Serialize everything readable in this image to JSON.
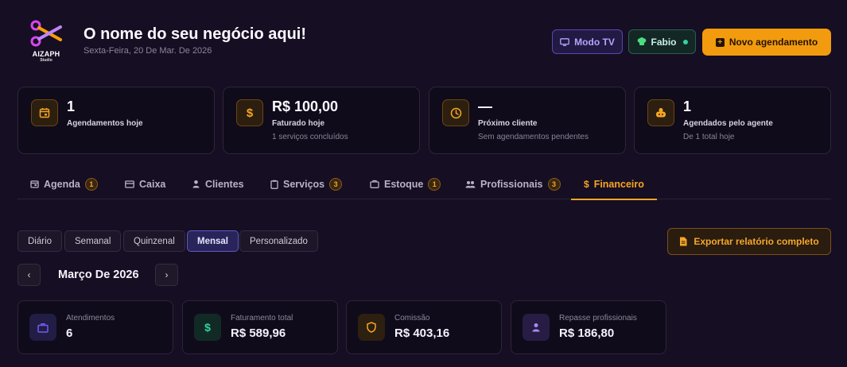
{
  "brand": {
    "name": "AIZAPH",
    "tagline": "Studio"
  },
  "header": {
    "title": "O nome do seu negócio aqui!",
    "date": "Sexta-Feira, 20 De Mar. De 2026",
    "tv_button": "Modo TV",
    "user_name": "Fabio",
    "new_button": "Novo agendamento"
  },
  "stats": [
    {
      "icon": "calendar-icon",
      "value": "1",
      "label": "Agendamentos hoje",
      "sub": ""
    },
    {
      "icon": "dollar-icon",
      "value": "R$ 100,00",
      "label": "Faturado hoje",
      "sub": "1 serviços concluídos"
    },
    {
      "icon": "clock-icon",
      "value": "—",
      "label": "Próximo cliente",
      "sub": "Sem agendamentos pendentes"
    },
    {
      "icon": "robot-icon",
      "value": "1",
      "label": "Agendados pelo agente",
      "sub": "De 1 total hoje"
    }
  ],
  "tabs": [
    {
      "label": "Agenda",
      "badge": "1",
      "icon": "calendar-icon"
    },
    {
      "label": "Caixa",
      "badge": "",
      "icon": "card-icon"
    },
    {
      "label": "Clientes",
      "badge": "",
      "icon": "person-icon"
    },
    {
      "label": "Serviços",
      "badge": "3",
      "icon": "clipboard-icon"
    },
    {
      "label": "Estoque",
      "badge": "1",
      "icon": "bag-icon"
    },
    {
      "label": "Profissionais",
      "badge": "3",
      "icon": "group-icon"
    },
    {
      "label": "Financeiro",
      "badge": "",
      "icon": "dollar-icon",
      "active": true
    }
  ],
  "periods": [
    "Diário",
    "Semanal",
    "Quinzenal",
    "Mensal",
    "Personalizado"
  ],
  "active_period": "Mensal",
  "export_button": "Exportar relatório completo",
  "month_label": "Março De 2026",
  "metrics": [
    {
      "icon": "briefcase-icon",
      "label": "Atendimentos",
      "value": "6",
      "color": "#6d5cf5"
    },
    {
      "icon": "dollar-icon",
      "label": "Faturamento total",
      "value": "R$ 589,96",
      "color": "#34d399"
    },
    {
      "icon": "shield-icon",
      "label": "Comissão",
      "value": "R$ 403,16",
      "color": "#f5a623"
    },
    {
      "icon": "person-icon",
      "label": "Repasse profissionais",
      "value": "R$ 186,80",
      "color": "#a78bfa"
    }
  ],
  "colors": {
    "accent": "#f29b0e",
    "background": "#160e23",
    "purple": "#6d5cf5",
    "green": "#34d399"
  }
}
